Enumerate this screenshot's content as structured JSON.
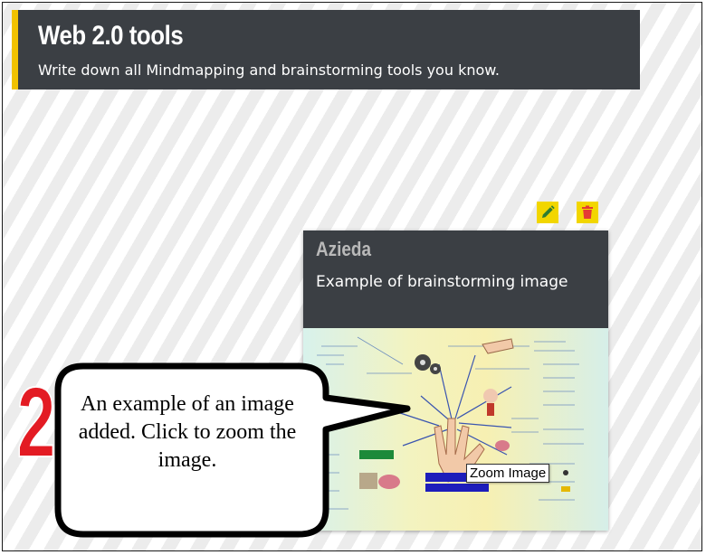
{
  "header": {
    "title": "Web 2.0 tools",
    "subtitle": "Write down all Mindmapping and brainstorming tools you know."
  },
  "post": {
    "author": "Azieda",
    "text": "Example of brainstorming image",
    "edit_icon": "pencil-icon",
    "delete_icon": "trash-icon"
  },
  "tooltip": {
    "label": "Zoom Image"
  },
  "annotation": {
    "step_number": "2",
    "callout_text": "An example of an image added. Click to zoom the image."
  },
  "colors": {
    "header_bg": "#3b3f44",
    "accent_yellow": "#f2c200",
    "edit_icon": "#2e7d32",
    "delete_icon": "#e53935",
    "step_number": "#e31b23"
  }
}
